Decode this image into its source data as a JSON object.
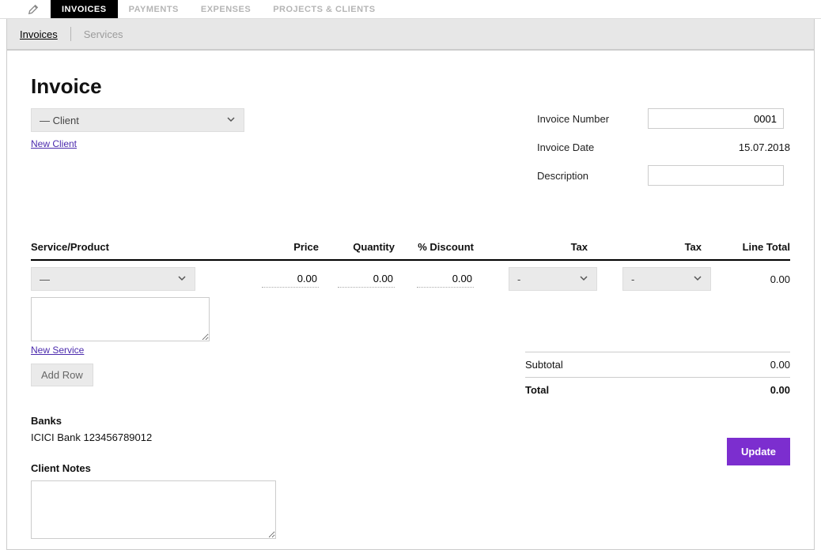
{
  "nav": {
    "tabs": [
      "INVOICES",
      "PAYMENTS",
      "EXPENSES",
      "PROJECTS & CLIENTS"
    ],
    "active_index": 0
  },
  "subnav": {
    "items": [
      "Invoices",
      "Services"
    ],
    "active_index": 0
  },
  "page": {
    "title": "Invoice",
    "client_select": "— Client",
    "new_client": "New Client",
    "new_service": "New Service",
    "add_row": "Add Row",
    "update": "Update"
  },
  "meta": {
    "labels": {
      "number": "Invoice Number",
      "date": "Invoice Date",
      "desc": "Description"
    },
    "values": {
      "number": "0001",
      "date": "15.07.2018",
      "desc": ""
    }
  },
  "line_headers": {
    "service": "Service/Product",
    "price": "Price",
    "qty": "Quantity",
    "discount": "% Discount",
    "tax1": "Tax",
    "tax2": "Tax",
    "total": "Line Total"
  },
  "line": {
    "service": "—",
    "price": "0.00",
    "qty": "0.00",
    "discount": "0.00",
    "tax1": "-",
    "tax2": "-",
    "total": "0.00",
    "desc": ""
  },
  "totals": {
    "subtotal_label": "Subtotal",
    "subtotal": "0.00",
    "total_label": "Total",
    "total": "0.00"
  },
  "banks": {
    "header": "Banks",
    "line": "ICICI Bank 123456789012"
  },
  "notes": {
    "header": "Client Notes",
    "value": ""
  }
}
